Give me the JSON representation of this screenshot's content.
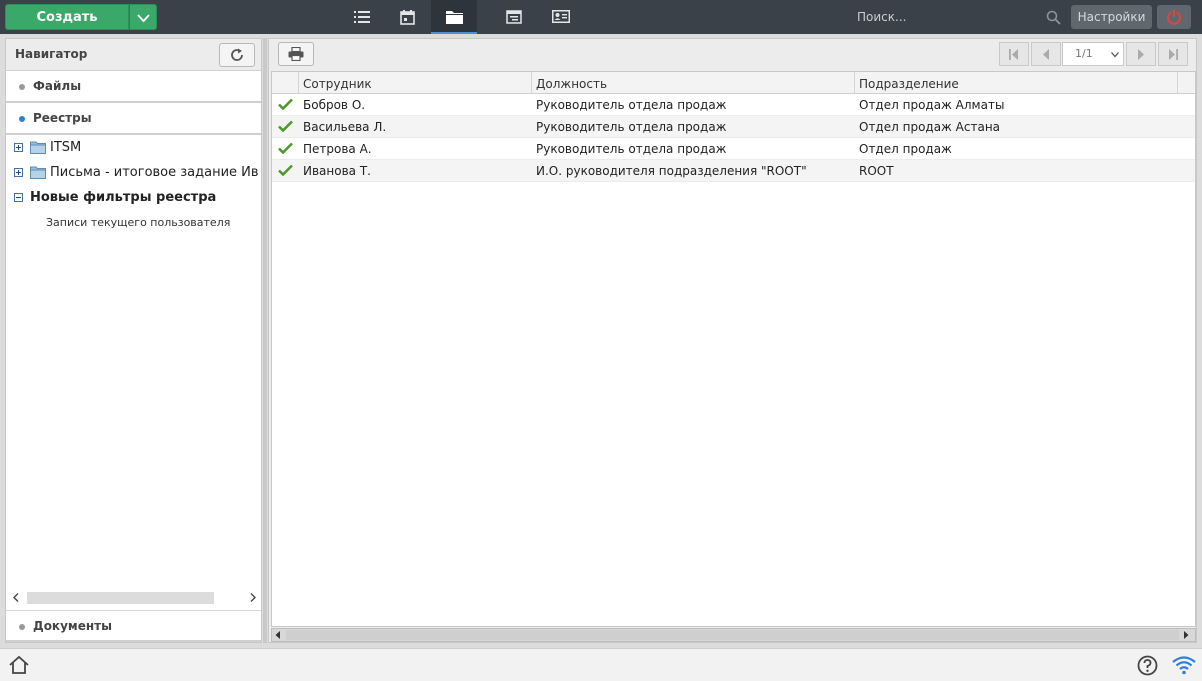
{
  "topbar": {
    "create_label": "Создать",
    "search_placeholder": "Поиск...",
    "settings_label": "Настройки",
    "icons": [
      "list-icon",
      "calendar-icon",
      "folder-icon",
      "document-icon",
      "contact-card-icon"
    ],
    "active_icon": "folder-icon"
  },
  "navigator": {
    "title": "Навигатор",
    "sections": {
      "files": "Файлы",
      "registries": "Реестры",
      "documents": "Документы"
    },
    "tree": [
      {
        "label": "ITSM",
        "expanded": false
      },
      {
        "label": "Письма - итоговое задание Ив",
        "expanded": false
      },
      {
        "label": "Новые фильтры реестра",
        "expanded": true
      }
    ],
    "subitem": "Записи текущего пользователя"
  },
  "pager": {
    "page": "1/1"
  },
  "grid": {
    "columns": [
      "Сотрудник",
      "Должность",
      "Подразделение"
    ],
    "rows": [
      {
        "employee": "Бобров О.",
        "position": "Руководитель отдела продаж",
        "department": "Отдел продаж Алматы"
      },
      {
        "employee": "Васильева Л.",
        "position": "Руководитель отдела продаж",
        "department": "Отдел продаж Астана"
      },
      {
        "employee": "Петрова А.",
        "position": "Руководитель отдела продаж",
        "department": "Отдел продаж"
      },
      {
        "employee": "Иванова Т.",
        "position": "И.О. руководителя подразделения \"ROOT\"",
        "department": "ROOT"
      }
    ]
  },
  "colors": {
    "create_green": "#3aa869",
    "topbar_bg": "#3a4149",
    "power_red": "#e2433b",
    "active_blue": "#4a90d9",
    "check_green": "#4e9a2a"
  }
}
